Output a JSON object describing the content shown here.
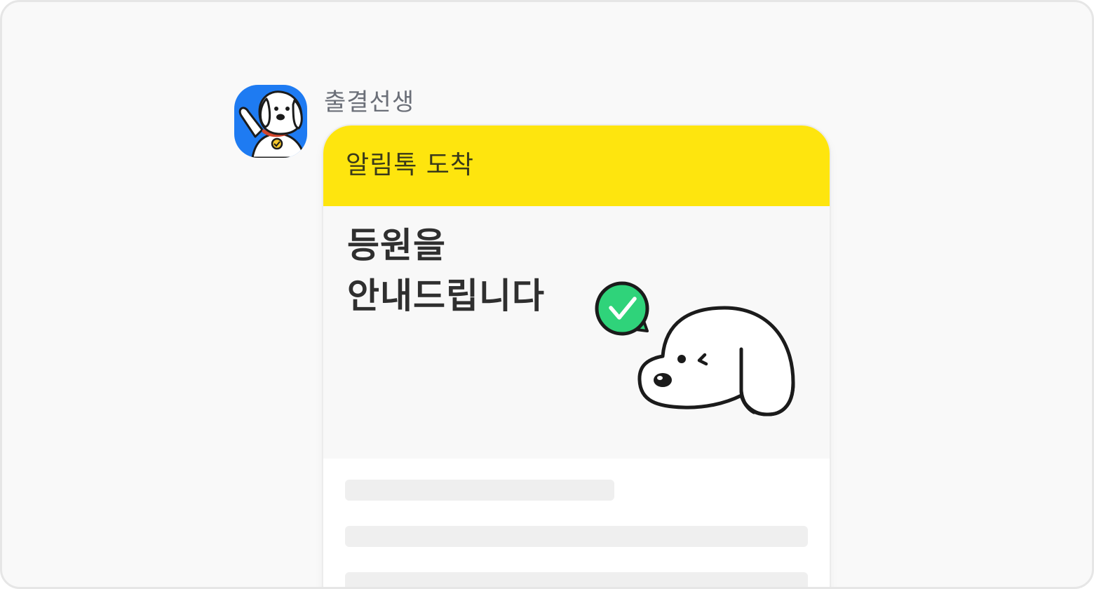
{
  "sender": {
    "name": "출결선생",
    "avatar_bg": "#1e7bf2"
  },
  "message_card": {
    "header_title": "알림톡 도착",
    "header_color": "#fee50e",
    "headline_line1": "등원을",
    "headline_line2": "안내드립니다",
    "check_badge_color": "#2fd37a",
    "illustration": "dog-mascot-winking"
  },
  "placeholder_lines": 3
}
